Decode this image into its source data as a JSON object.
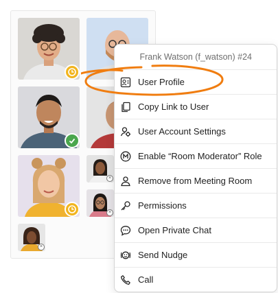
{
  "menu": {
    "header": "Frank Watson (f_watson) #24",
    "items": [
      {
        "label": "User Profile",
        "icon": "user-card-icon"
      },
      {
        "label": "Copy Link to User",
        "icon": "copy-link-icon"
      },
      {
        "label": "User Account Settings",
        "icon": "user-settings-icon"
      },
      {
        "label": "Enable “Room Moderator” Role",
        "icon": "moderator-m-icon"
      },
      {
        "label": "Remove from Meeting Room",
        "icon": "remove-user-icon"
      },
      {
        "label": "Permissions",
        "icon": "key-icon"
      },
      {
        "label": "Open Private Chat",
        "icon": "chat-bubble-icon"
      },
      {
        "label": "Send Nudge",
        "icon": "nudge-face-icon"
      },
      {
        "label": "Call",
        "icon": "phone-icon"
      }
    ]
  },
  "participants": [
    {
      "status": "away"
    },
    {
      "status": "none"
    },
    {
      "status": "online"
    },
    {
      "status": "none"
    },
    {
      "status": "away"
    },
    {
      "status": "offline"
    },
    {
      "status": "offline"
    },
    {
      "status": "offline"
    }
  ],
  "colors": {
    "highlight": "#f07d10",
    "away": "#f2b51f",
    "online": "#4aa64d"
  }
}
